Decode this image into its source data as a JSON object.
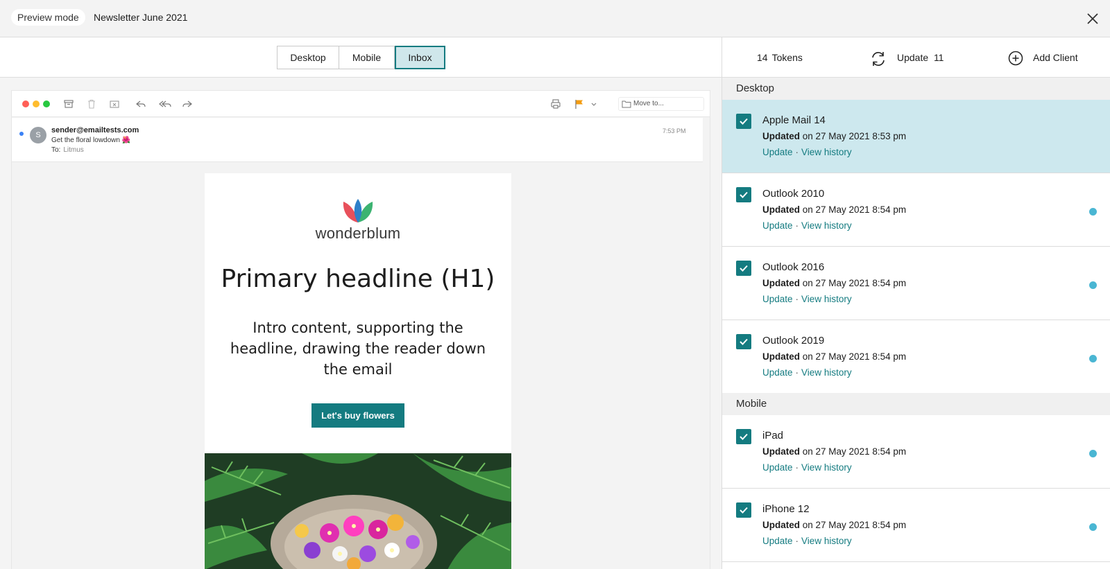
{
  "topbar": {
    "mode_label": "Preview mode",
    "title": "Newsletter June 2021"
  },
  "view_tabs": [
    {
      "label": "Desktop",
      "active": false
    },
    {
      "label": "Mobile",
      "active": false
    },
    {
      "label": "Inbox",
      "active": true
    }
  ],
  "mail": {
    "move_to_placeholder": "Move to...",
    "avatar_initial": "S",
    "sender": "sender@emailtests.com",
    "subject": "Get the floral lowdown 🌺",
    "to_label": "To:",
    "to_value": "Litmus",
    "time": "7:53 PM"
  },
  "email": {
    "brand": "wonderblum",
    "headline": "Primary headline (H1)",
    "intro": "Intro content, supporting the headline, drawing the reader down the email",
    "cta_label": "Let's buy flowers"
  },
  "right_toolbar": {
    "tokens_count": "14",
    "tokens_label": "Tokens",
    "update_label": "Update",
    "update_count": "11",
    "add_client_label": "Add Client"
  },
  "sections": {
    "desktop": "Desktop",
    "mobile": "Mobile"
  },
  "clients": [
    {
      "name": "Apple Mail 14",
      "updated_label": "Updated",
      "updated_on": "on 27 May 2021 8:53 pm",
      "update_link": "Update",
      "history_link": "View history",
      "selected": true,
      "has_dot": false
    },
    {
      "name": "Outlook 2010",
      "updated_label": "Updated",
      "updated_on": "on 27 May 2021 8:54 pm",
      "update_link": "Update",
      "history_link": "View history",
      "selected": false,
      "has_dot": true
    },
    {
      "name": "Outlook 2016",
      "updated_label": "Updated",
      "updated_on": "on 27 May 2021 8:54 pm",
      "update_link": "Update",
      "history_link": "View history",
      "selected": false,
      "has_dot": true
    },
    {
      "name": "Outlook 2019",
      "updated_label": "Updated",
      "updated_on": "on 27 May 2021 8:54 pm",
      "update_link": "Update",
      "history_link": "View history",
      "selected": false,
      "has_dot": true
    },
    {
      "name": "iPad",
      "updated_label": "Updated",
      "updated_on": "on 27 May 2021 8:54 pm",
      "update_link": "Update",
      "history_link": "View history",
      "selected": false,
      "has_dot": true
    },
    {
      "name": "iPhone 12",
      "updated_label": "Updated",
      "updated_on": "on 27 May 2021 8:54 pm",
      "update_link": "Update",
      "history_link": "View history",
      "selected": false,
      "has_dot": true
    }
  ],
  "colors": {
    "accent": "#147b80",
    "selected_row": "#cde8ee",
    "status_dot": "#4ab6d3"
  }
}
